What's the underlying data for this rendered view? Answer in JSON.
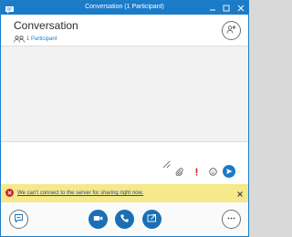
{
  "window": {
    "title": "Conversation (1 Participant)"
  },
  "header": {
    "title": "Conversation",
    "participant_count": "1 Participant",
    "add_people_icon": "add-people-icon"
  },
  "compose": {
    "placeholder": "",
    "tools": [
      "attach-icon",
      "importance-icon",
      "emoticon-icon",
      "send-icon"
    ]
  },
  "notification": {
    "message": "We can't connect to the server for sharing right now.",
    "status_color": "#c8282d",
    "background": "#f6e98c"
  },
  "toolbar": {
    "buttons": [
      "im-icon",
      "video-icon",
      "phone-icon",
      "present-icon",
      "more-options-icon"
    ]
  },
  "colors": {
    "accent": "#1a7bc9",
    "button_fill": "#1a6fb5"
  }
}
